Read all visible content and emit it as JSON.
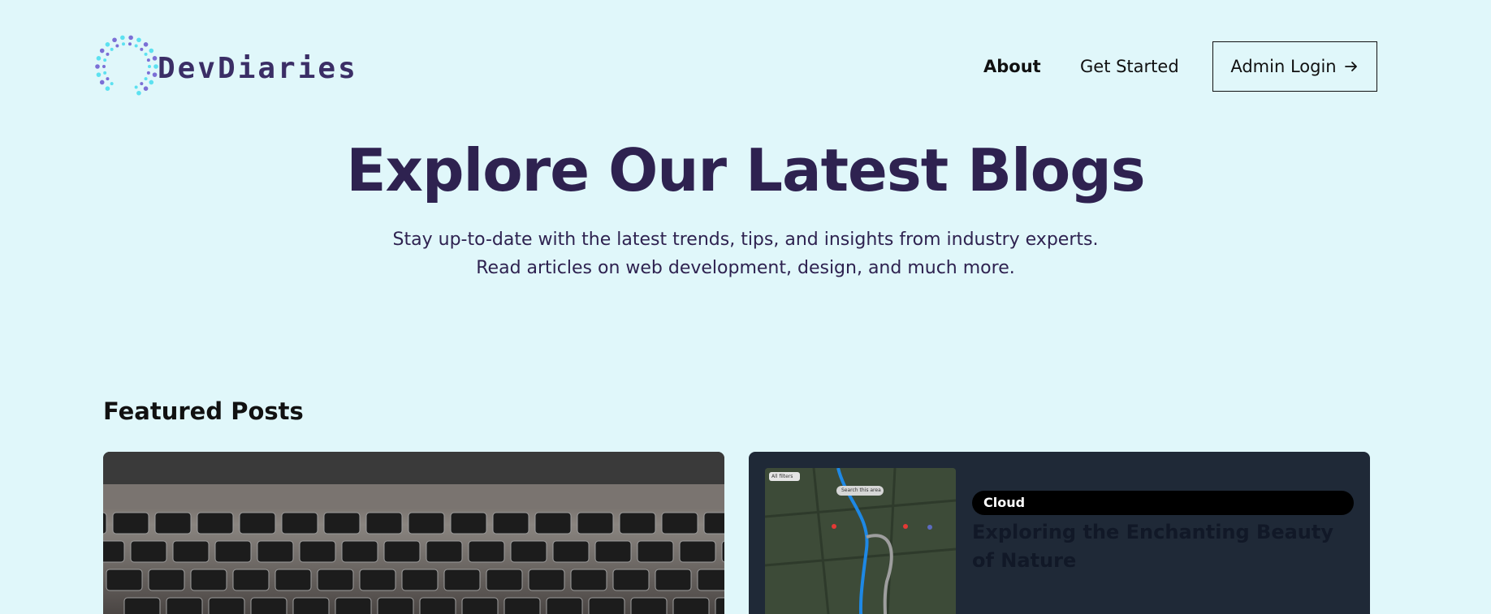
{
  "brand": {
    "name": "DevDiaries",
    "accent": "#3b2e66",
    "dot_color_1": "#5ce1f0",
    "dot_color_2": "#7b6fd6"
  },
  "nav": {
    "about": "About",
    "get_started": "Get Started",
    "admin_login": "Admin Login"
  },
  "hero": {
    "title": "Explore Our Latest Blogs",
    "subtitle": "Stay up-to-date with the latest trends, tips, and insights from industry experts. Read articles on web development, design, and much more."
  },
  "featured": {
    "section_title": "Featured Posts",
    "posts": [
      {
        "image": "laptop-keyboard-photo"
      },
      {
        "image": "satellite-map-screenshot",
        "map_search_label": "Search this area",
        "map_filter_label": "All filters",
        "tag": "Cloud",
        "title": "Exploring the Enchanting Beauty of Nature"
      }
    ]
  },
  "icons": {
    "admin_arrow": "arrow-right-icon"
  }
}
